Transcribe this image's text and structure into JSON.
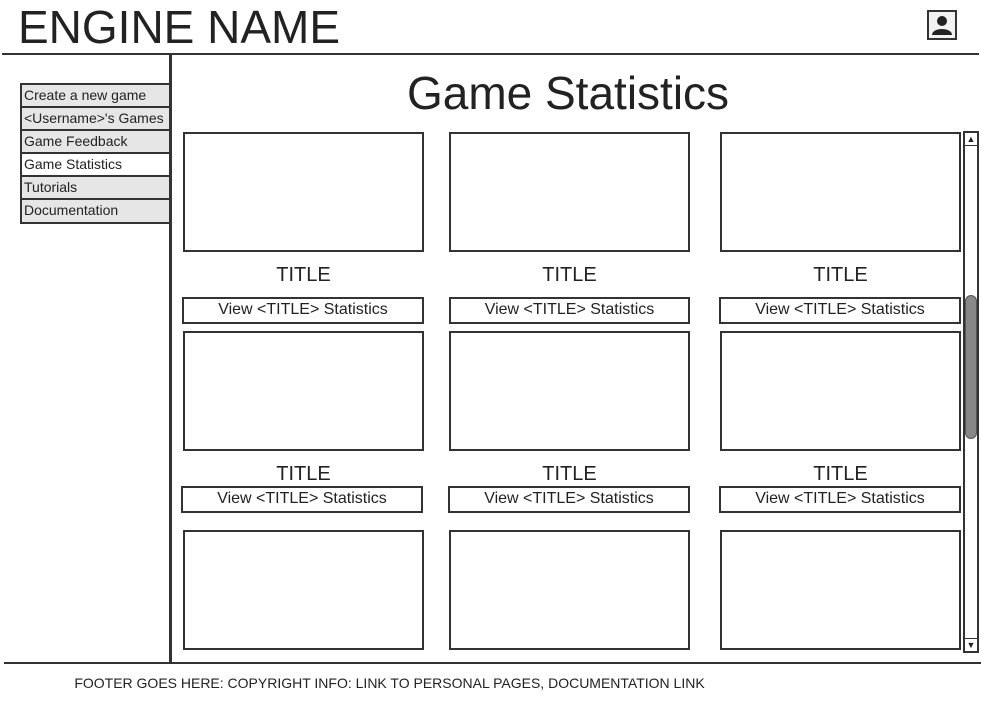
{
  "header": {
    "engine_name": "ENGINE NAME",
    "profile_icon": "user-icon"
  },
  "sidebar": {
    "items": [
      {
        "label": "Create a new game"
      },
      {
        "label": "<Username>'s Games"
      },
      {
        "label": "Game Feedback"
      },
      {
        "label": "Game Statistics",
        "active": true
      },
      {
        "label": "Tutorials"
      },
      {
        "label": "Documentation"
      }
    ]
  },
  "main": {
    "title": "Game Statistics",
    "cards": [
      {
        "title": "TITLE",
        "button": "View <TITLE> Statistics"
      },
      {
        "title": "TITLE",
        "button": "View <TITLE> Statistics"
      },
      {
        "title": "TITLE",
        "button": "View <TITLE> Statistics"
      },
      {
        "title": "TITLE",
        "button": "View <TITLE> Statistics"
      },
      {
        "title": "TITLE",
        "button": "View <TITLE> Statistics"
      },
      {
        "title": "TITLE",
        "button": "View <TITLE> Statistics"
      }
    ]
  },
  "scrollbar": {
    "up_icon": "arrow-up-icon",
    "down_icon": "arrow-down-icon"
  },
  "footer": {
    "text": "FOOTER GOES HERE: COPYRIGHT INFO: LINK TO PERSONAL PAGES, DOCUMENTATION LINK"
  }
}
